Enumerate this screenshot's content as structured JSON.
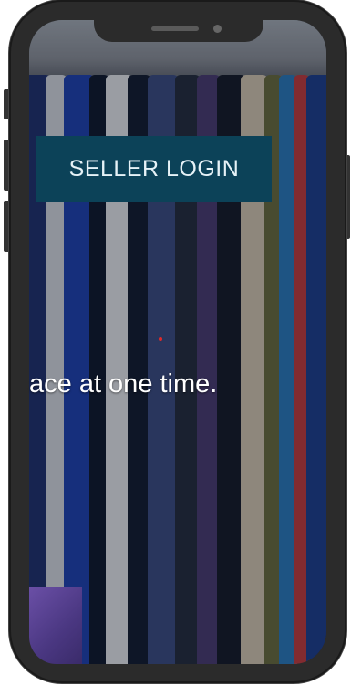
{
  "screen": {
    "seller_login_label": "SELLER LOGIN",
    "tagline_text": "ace at one time."
  },
  "colors": {
    "button_bg": "#0c4258",
    "button_text": "#e6f2f7",
    "phone_frame": "#2b2b2b",
    "tagline_text": "#ffffff"
  },
  "icons": {
    "speaker": "speaker-grille-icon",
    "camera": "front-camera-icon"
  }
}
